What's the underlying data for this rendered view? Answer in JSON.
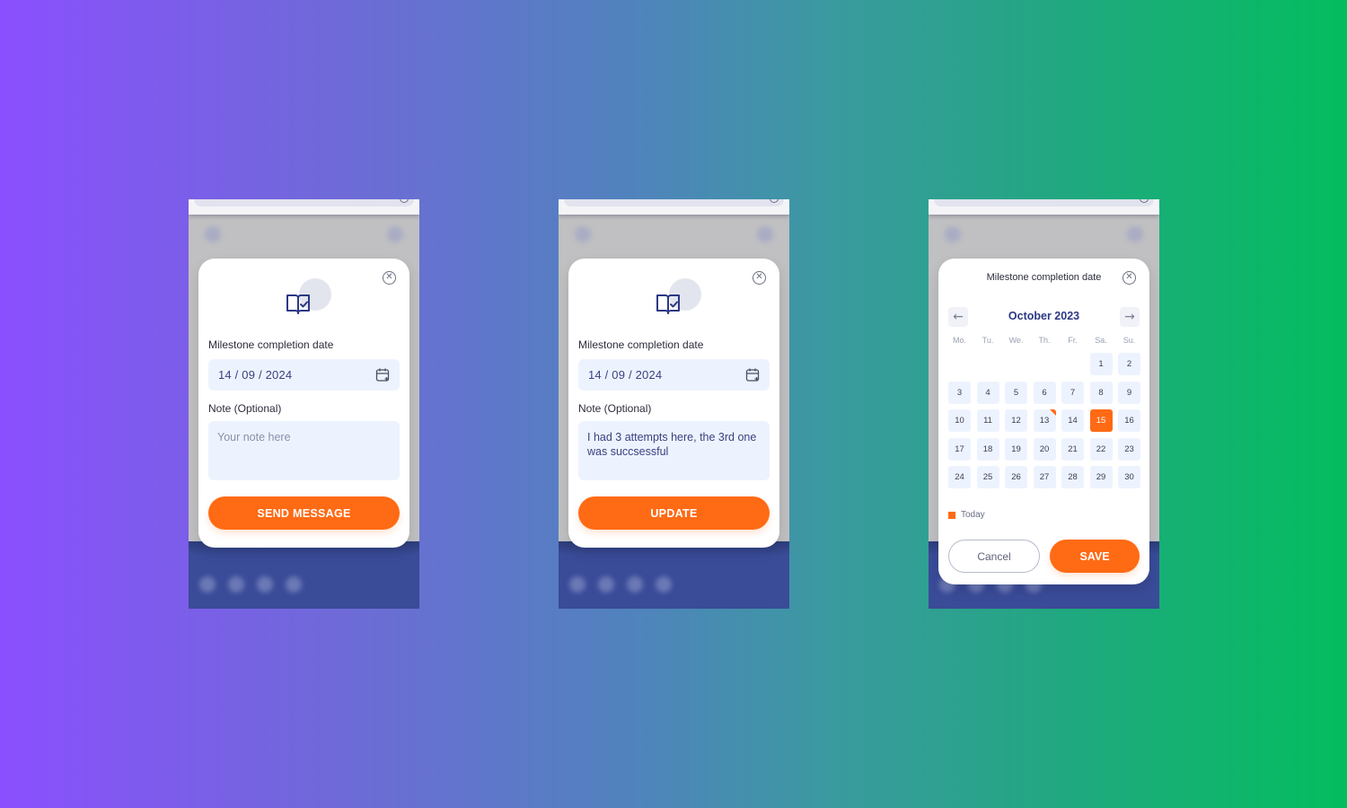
{
  "colors": {
    "accent": "#ff6a14",
    "primary_text": "#2c3884",
    "field_bg": "#edf3fe",
    "gradient_start": "#8a4ffe",
    "gradient_end": "#03bd5e"
  },
  "screens": [
    {
      "id": "empty-form",
      "icon": "book-check-icon",
      "close_icon": "close-circle-icon",
      "close_glyph": "✕",
      "date_label": "Milestone completion date",
      "date_value": "14 / 09 / 2024",
      "calendar_icon": "calendar-plus-icon",
      "note_label": "Note (Optional)",
      "note_placeholder": "Your note here",
      "note_value": "",
      "button_label": "SEND MESSAGE"
    },
    {
      "id": "filled-form",
      "icon": "book-check-icon",
      "close_icon": "close-circle-icon",
      "close_glyph": "✕",
      "date_label": "Milestone completion date",
      "date_value": "14 / 09 / 2024",
      "calendar_icon": "calendar-plus-icon",
      "note_label": "Note (Optional)",
      "note_placeholder": "Your note here",
      "note_value": "I had 3 attempts here, the 3rd one was succsessful",
      "button_label": "UPDATE"
    },
    {
      "id": "date-picker",
      "title": "Milestone completion date",
      "close_glyph": "✕",
      "prev_glyph": "←",
      "next_glyph": "→",
      "month_label": "October 2023",
      "weekdays": [
        "Mo.",
        "Tu.",
        "We.",
        "Th.",
        "Fr.",
        "Sa.",
        "Su."
      ],
      "leading_empty_days": 5,
      "days": [
        "1",
        "2",
        "3",
        "4",
        "5",
        "6",
        "7",
        "8",
        "9",
        "10",
        "11",
        "12",
        "13",
        "14",
        "15",
        "16",
        "17",
        "18",
        "19",
        "20",
        "21",
        "22",
        "23",
        "24",
        "25",
        "26",
        "27",
        "28",
        "29",
        "30"
      ],
      "selected_day": "15",
      "marked_day": "13",
      "legend_label": "Today",
      "cancel_label": "Cancel",
      "save_label": "SAVE"
    }
  ]
}
